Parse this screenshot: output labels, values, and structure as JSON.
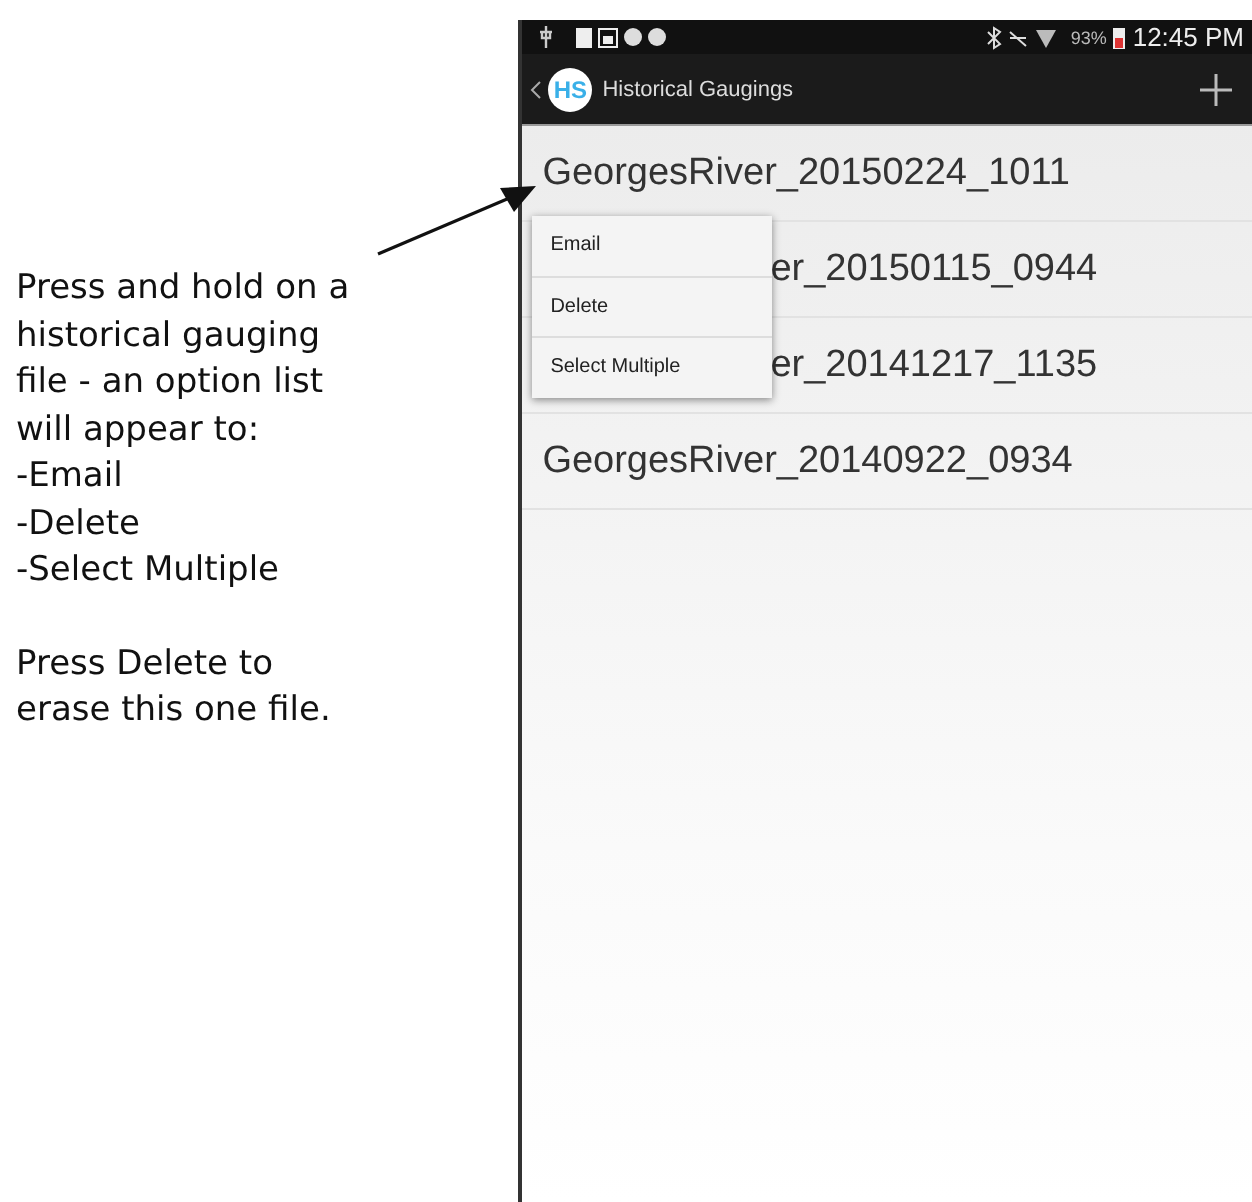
{
  "annotation": {
    "text": "Press and hold on a\nhistorical gauging\nfile - an option list\nwill appear to:\n-Email\n-Delete\n-Select Multiple",
    "note": "Press Delete to\nerase this one file."
  },
  "status_bar": {
    "battery": "93%",
    "time": "12:45 PM"
  },
  "action_bar": {
    "logo": "HS",
    "title": "Historical Gaugings"
  },
  "files": [
    {
      "name": "GeorgesRiver_20150224_1011",
      "behind_menu": false
    },
    {
      "name": "er_20150115_0944",
      "behind_menu": true
    },
    {
      "name": "er_20141217_1135",
      "behind_menu": true
    },
    {
      "name": "GeorgesRiver_20140922_0934",
      "behind_menu": false
    }
  ],
  "context_menu": [
    "Email",
    "Delete",
    "Select Multiple"
  ]
}
